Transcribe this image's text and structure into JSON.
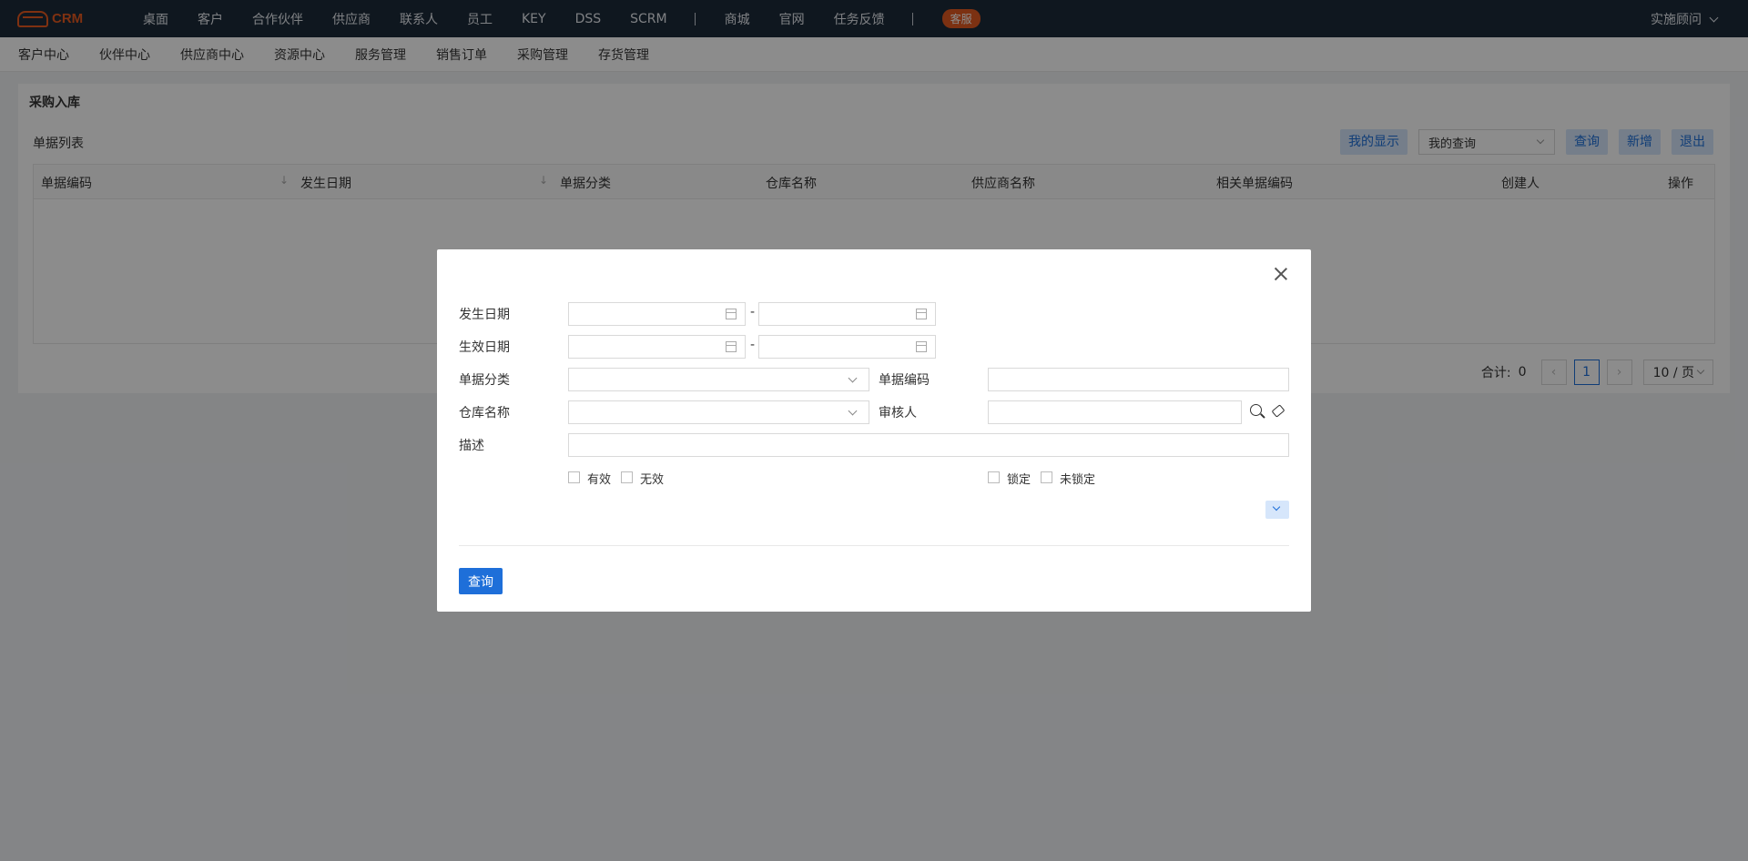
{
  "app": {
    "logo_text": "CRM",
    "badge": "客服",
    "user": "实施顾问"
  },
  "topnav": [
    "桌面",
    "客户",
    "合作伙伴",
    "供应商",
    "联系人",
    "员工",
    "KEY",
    "DSS",
    "SCRM",
    "商城",
    "官网",
    "任务反馈"
  ],
  "subnav": [
    "客户中心",
    "伙伴中心",
    "供应商中心",
    "资源中心",
    "服务管理",
    "销售订单",
    "采购管理",
    "存货管理"
  ],
  "page": {
    "title": "采购入库",
    "list_title": "单据列表",
    "toolbar": {
      "my_display": "我的显示",
      "my_query": "我的查询",
      "query": "查询",
      "add": "新增",
      "exit": "退出"
    },
    "columns": [
      "单据编码",
      "发生日期",
      "单据分类",
      "仓库名称",
      "供应商名称",
      "相关单据编码",
      "创建人",
      "操作"
    ],
    "pager": {
      "total_label": "合计:",
      "total": "0",
      "page": "1",
      "page_size": "10 / 页"
    }
  },
  "modal": {
    "labels": {
      "occur_date": "发生日期",
      "effective_date": "生效日期",
      "doc_category": "单据分类",
      "doc_code": "单据编码",
      "warehouse": "仓库名称",
      "reviewer": "审核人",
      "description": "描述"
    },
    "range_sep": "-",
    "checkboxes_left": [
      "有效",
      "无效"
    ],
    "checkboxes_right": [
      "锁定",
      "未锁定"
    ],
    "submit": "查询"
  }
}
